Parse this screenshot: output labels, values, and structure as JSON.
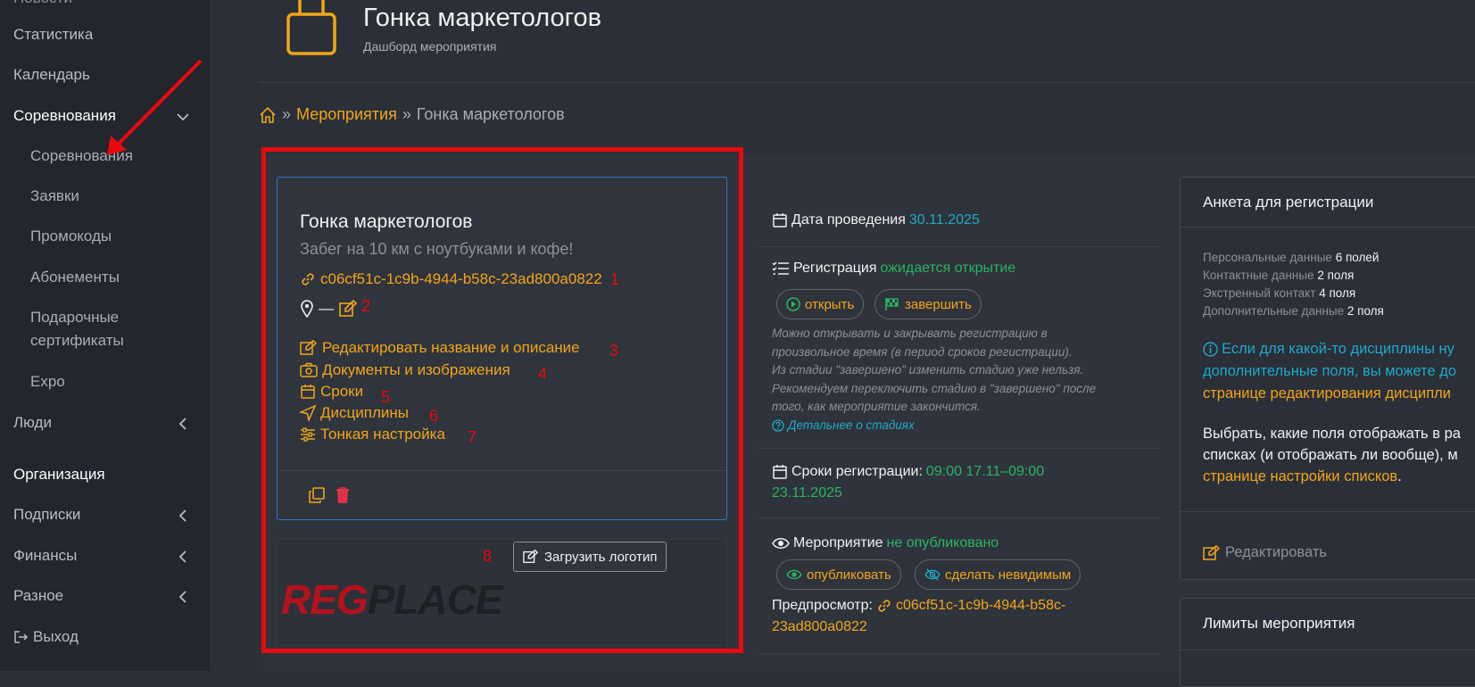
{
  "sidebar": {
    "items": [
      {
        "label": "Статистика"
      },
      {
        "label": "Календарь"
      },
      {
        "label": "Соревнования"
      },
      {
        "label": "Соревнования"
      },
      {
        "label": "Заявки"
      },
      {
        "label": "Промокоды"
      },
      {
        "label": "Абонементы"
      },
      {
        "label": "Подарочные"
      },
      {
        "label": "сертификаты"
      },
      {
        "label": "Expo"
      },
      {
        "label": "Люди"
      },
      {
        "label": "Организация"
      },
      {
        "label": "Подписки"
      },
      {
        "label": "Финансы"
      },
      {
        "label": "Разное"
      },
      {
        "label": "Выход"
      }
    ]
  },
  "header": {
    "title": "Гонка маркетологов",
    "subtitle": "Дашборд мероприятия"
  },
  "breadcrumb": {
    "sep1": "»",
    "link": "Мероприятия",
    "sep2": "»",
    "current": "Гонка маркетологов"
  },
  "event_card": {
    "title": "Гонка маркетологов",
    "description": "Забег на 10 км с ноутбуками и кофе!",
    "link_id": "c06cf51c-1c9b-4944-b58c-23ad800a0822",
    "location_dash": "—",
    "actions": [
      {
        "label": "Редактировать название и описание"
      },
      {
        "label": "Документы и изображения"
      },
      {
        "label": "Сроки"
      },
      {
        "label": "Дисциплины"
      },
      {
        "label": "Тонкая настройка"
      }
    ],
    "annotations": [
      "1",
      "2",
      "3",
      "4",
      "5",
      "6",
      "7",
      "8"
    ]
  },
  "logo_card": {
    "upload_label": "Загрузить логотип",
    "logo_part1": "REG",
    "logo_part2": "PLACE"
  },
  "middle": {
    "date_label": "Дата проведения",
    "date_value": "30.11.2025",
    "registration_label": "Регистрация",
    "registration_status": "ожидается открытие",
    "open_btn": "открыть",
    "finish_btn": "завершить",
    "note_lines": [
      "Можно открывать и закрывать регистрацию в",
      "произвольное время (в период сроков регистрации).",
      "Из стадии \"завершено\" изменить стадию уже нельзя.",
      "Рекомендуем переключить стадию в \"завершено\" после",
      "того, как мероприятие закончится."
    ],
    "stages_link": "Детальнее о стадиях",
    "reg_period_label": "Сроки регистрации:",
    "reg_period_value_1": "09:00 17.11–09:00",
    "reg_period_value_2": "23.11.2025",
    "event_label": "Мероприятие",
    "event_status": "не опубликовано",
    "publish_btn": "опубликовать",
    "invisible_btn": "сделать невидимым",
    "preview_label": "Предпросмотр:",
    "preview_link_1": "c06cf51c-1c9b-4944-b58c-",
    "preview_link_2": "23ad800a0822"
  },
  "right": {
    "form_title": "Анкета для регистрации",
    "fields": [
      {
        "label": "Персональные данные",
        "count": "6 полей"
      },
      {
        "label": "Контактные данные",
        "count": "2 поля"
      },
      {
        "label": "Экстренный контакт",
        "count": "4 поля"
      },
      {
        "label": "Дополнительные данные",
        "count": "2 поля"
      }
    ],
    "info_line1": "Если для какой-то дисциплины ну",
    "info_line2": "дополнительные поля, вы можете до",
    "info_line3": "странице редактирования дисципли",
    "para_line1": "Выбрать, какие поля отображать в ра",
    "para_line2": "списках (и отображать ли вообще), м",
    "para_line3": "странице настройки списков",
    "para_dot": ".",
    "edit_label": "Редактировать",
    "limits_title": "Лимиты мероприятия"
  },
  "colors": {
    "accent": "#f0a51a",
    "highlight_frame": "#e8090f",
    "success": "#28b463",
    "info": "#1fa8c9",
    "card_border": "#2f77c4"
  }
}
